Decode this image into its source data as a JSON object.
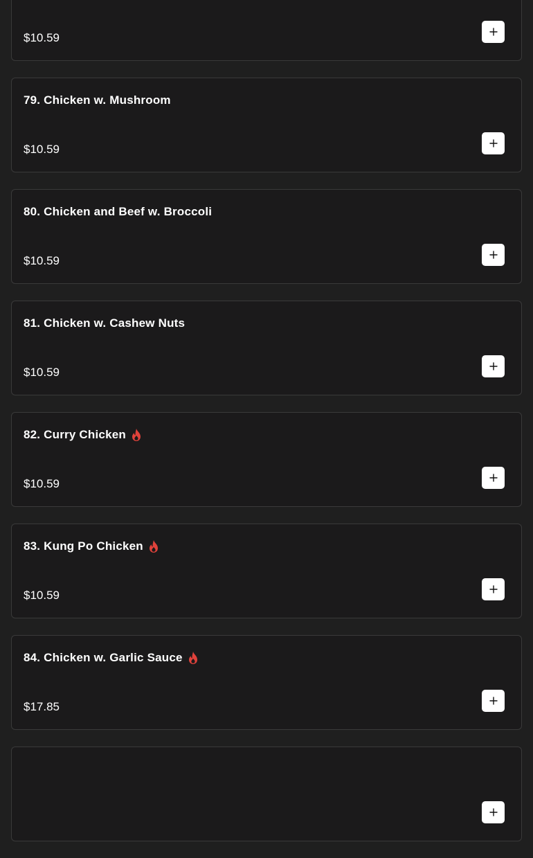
{
  "currency_note": "",
  "colors": {
    "background": "#1f1f1f",
    "card": "#1b1a1b",
    "card_border": "#3a3a3a",
    "text": "#ffffff",
    "spicy": "#e0423b",
    "add_button": "#ffffff"
  },
  "icons": {
    "spicy": "flame-icon",
    "add": "plus-icon"
  },
  "items": [
    {
      "name": "",
      "price": "$10.59",
      "spicy": false
    },
    {
      "name": "79. Chicken w. Mushroom",
      "price": "$10.59",
      "spicy": false
    },
    {
      "name": "80. Chicken and Beef w. Broccoli",
      "price": "$10.59",
      "spicy": false
    },
    {
      "name": "81. Chicken w. Cashew Nuts",
      "price": "$10.59",
      "spicy": false
    },
    {
      "name": "82. Curry Chicken",
      "price": "$10.59",
      "spicy": true
    },
    {
      "name": "83. Kung Po Chicken",
      "price": "$10.59",
      "spicy": true
    },
    {
      "name": "84. Chicken w. Garlic Sauce",
      "price": "$17.85",
      "spicy": true
    },
    {
      "name": "",
      "price": "",
      "spicy": false
    }
  ]
}
